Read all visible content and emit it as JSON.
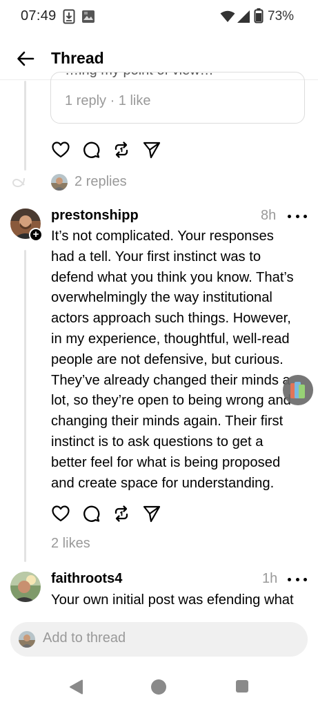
{
  "status_bar": {
    "time": "07:49",
    "battery": "73%",
    "icons": [
      "download-notification-icon",
      "photo-notification-icon",
      "wifi-icon",
      "cell-signal-icon",
      "battery-icon"
    ]
  },
  "header": {
    "title": "Thread",
    "back_icon": "arrow-left-icon"
  },
  "quote_card": {
    "partial_text": "…ing my point of view…",
    "meta": "1 reply · 1 like"
  },
  "first_post_actions": {
    "icons": [
      "heart-icon",
      "comment-icon",
      "repost-icon",
      "share-icon"
    ]
  },
  "replies_summary": {
    "text": "2 replies"
  },
  "posts": [
    {
      "username": "prestonshipp",
      "time": "8h",
      "lines": [
        "It’s not complicated. Your responses",
        "had a tell. Your first instinct was to",
        "defend what you think you know. That’s",
        "overwhelmingly the way institutional",
        "actors approach such things. However,",
        "in my experience, thoughtful, well-read",
        "people are not defensive, but curious.",
        "They’ve already changed their minds a",
        "lot, so they’re open to being wrong and",
        "changing their minds again. Their first",
        "instinct is to ask questions to get a",
        "better feel for what is being proposed",
        "and create space for understanding."
      ],
      "likes": "2 likes",
      "follow_badge": "+"
    },
    {
      "username": "faithroots4",
      "time": "1h",
      "lines": [
        "Your own initial post was efending what"
      ]
    }
  ],
  "compose": {
    "placeholder": "Add to thread"
  },
  "nav_bar": {
    "icons": [
      "nav-back-icon",
      "nav-home-icon",
      "nav-recents-icon"
    ]
  },
  "colors": {
    "text": "#000000",
    "muted": "#999999",
    "divider": "#e3e3e3",
    "compose_bg": "#f0f0f0"
  }
}
